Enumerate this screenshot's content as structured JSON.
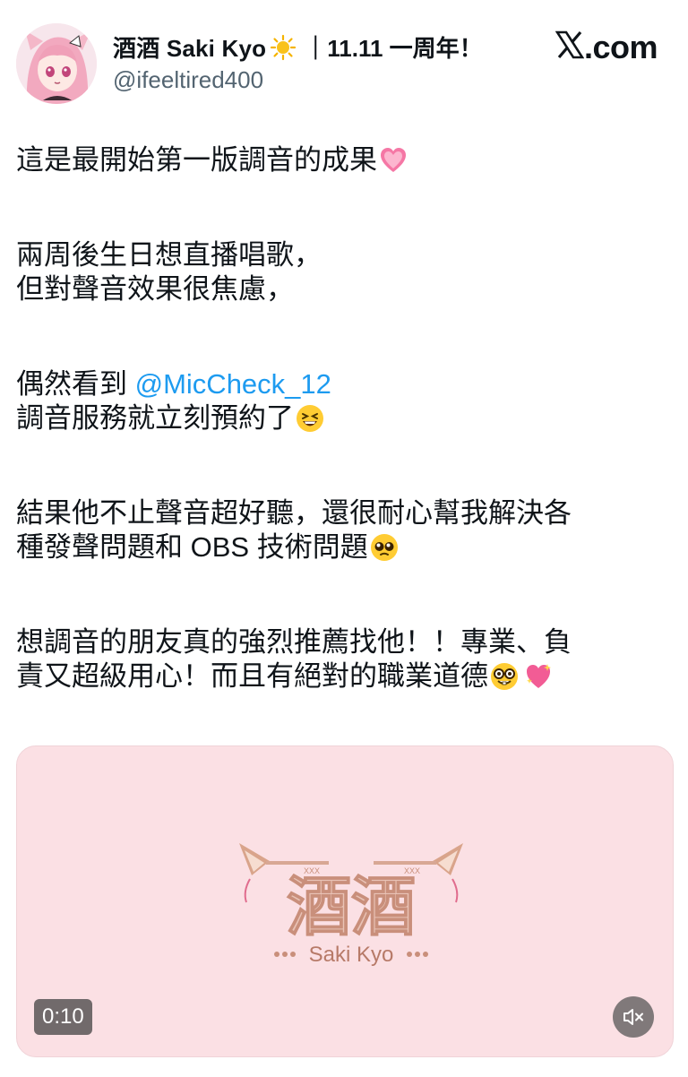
{
  "profile": {
    "display_name": "酒酒 Saki Kyo",
    "anniversary": "｜11.11 一周年！",
    "handle": "@ifeeltired400",
    "avatar_icon": "anime-avatar-icon"
  },
  "brand": {
    "logo_icon": "x-logo-icon",
    "text": ".com"
  },
  "tweet": {
    "line1": "這是最開始第一版調音的成果",
    "line2": "兩周後生日想直播唱歌，",
    "line3": "但對聲音效果很焦慮，",
    "line4_prefix": "偶然看到 ",
    "mention": "@MicCheck_12",
    "line5": "調音服務就立刻預約了",
    "line6": "結果他不止聲音超好聽，還很耐心幫我解決各",
    "line7": "種發聲問題和 OBS 技術問題",
    "line8": "想調音的朋友真的強烈推薦找他！！專業、負",
    "line9": "責又超級用心！而且有絕對的職業道德",
    "emojis": [
      "pink-heart-icon",
      "grinning-squint-icon",
      "pleading-face-icon",
      "nerd-face-icon",
      "sparkling-heart-icon"
    ]
  },
  "media": {
    "logo_title": "酒酒",
    "logo_subtitle": "Saki Kyo",
    "logo_tag_left": "XXX",
    "logo_tag_right": "XXX",
    "duration": "0:10",
    "mute_icon": "speaker-muted-icon",
    "background_color": "#fbe0e4"
  },
  "colors": {
    "mention": "#1d9bf0",
    "handle": "#536471",
    "text": "#0f1419"
  }
}
